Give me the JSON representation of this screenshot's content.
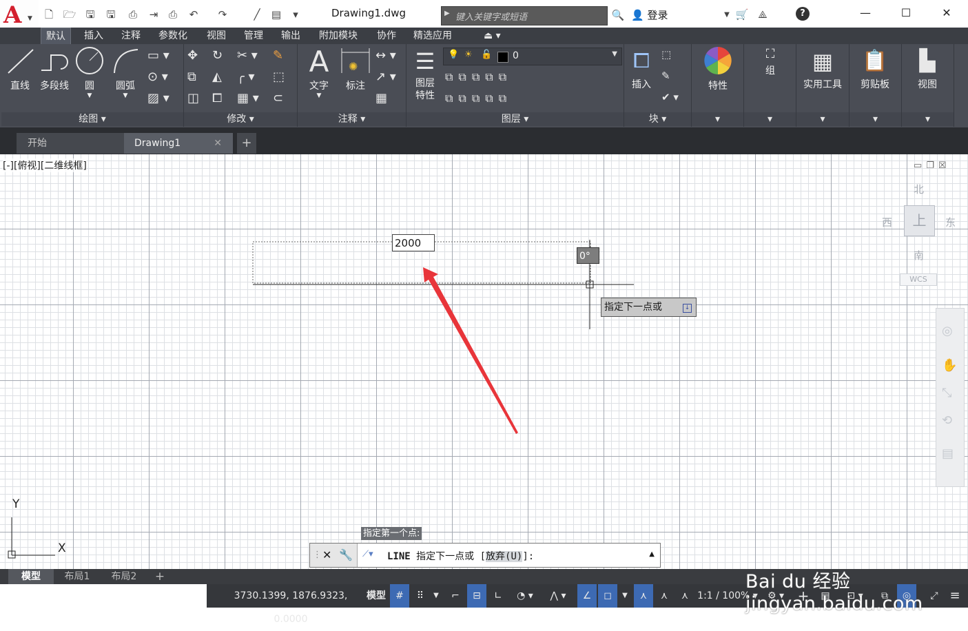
{
  "app": {
    "logo": "A",
    "doc_title": "Drawing1.dwg"
  },
  "quick_access": [
    "new-icon",
    "open-icon",
    "save-icon",
    "saveas-icon",
    "import-icon",
    "export-icon",
    "print-icon",
    "undo-icon",
    "redo-icon",
    "match-icon",
    "properties-icon",
    "more-icon"
  ],
  "search": {
    "placeholder": "键入关键字或短语"
  },
  "user": {
    "login": "登录"
  },
  "menu_tabs": [
    "默认",
    "插入",
    "注释",
    "参数化",
    "视图",
    "管理",
    "输出",
    "附加模块",
    "协作",
    "精选应用"
  ],
  "ribbon": {
    "draw": {
      "title": "绘图",
      "line": "直线",
      "polyline": "多段线",
      "circle": "圆",
      "arc": "圆弧"
    },
    "modify": {
      "title": "修改"
    },
    "annotation": {
      "title": "注释",
      "text": "文字",
      "dimension": "标注"
    },
    "layers": {
      "title": "图层",
      "properties_line1": "图层",
      "properties_line2": "特性",
      "current_layer": "0"
    },
    "block": {
      "title": "块",
      "insert": "插入"
    },
    "properties": {
      "label": "特性"
    },
    "groups": {
      "label": "组"
    },
    "utilities": {
      "label": "实用工具"
    },
    "clipboard": {
      "label": "剪贴板"
    },
    "view": {
      "label": "视图"
    }
  },
  "doc_tabs": {
    "start": "开始",
    "drawing": "Drawing1",
    "new": "+"
  },
  "viewport": {
    "label": "[-][俯视][二维线框]"
  },
  "dynamic_input": {
    "value": "2000",
    "angle": "0°",
    "prompt": "指定下一点或"
  },
  "viewcube": {
    "north": "北",
    "south": "南",
    "east": "东",
    "west": "西",
    "top": "上",
    "wcs": "WCS"
  },
  "ucs": {
    "x": "X",
    "y": "Y"
  },
  "command": {
    "history": "指定第一个点:",
    "name": "LINE",
    "prompt": "指定下一点或 [",
    "option": "放弃(U)",
    "suffix": "]:"
  },
  "layout_tabs": [
    "模型",
    "布局1",
    "布局2"
  ],
  "status": {
    "coords": "3730.1399, 1876.9323, 0.0000",
    "model": "模型",
    "scale": "1:1 / 100%"
  },
  "watermark": "Bai du 经验 jingyan.baidu.com"
}
